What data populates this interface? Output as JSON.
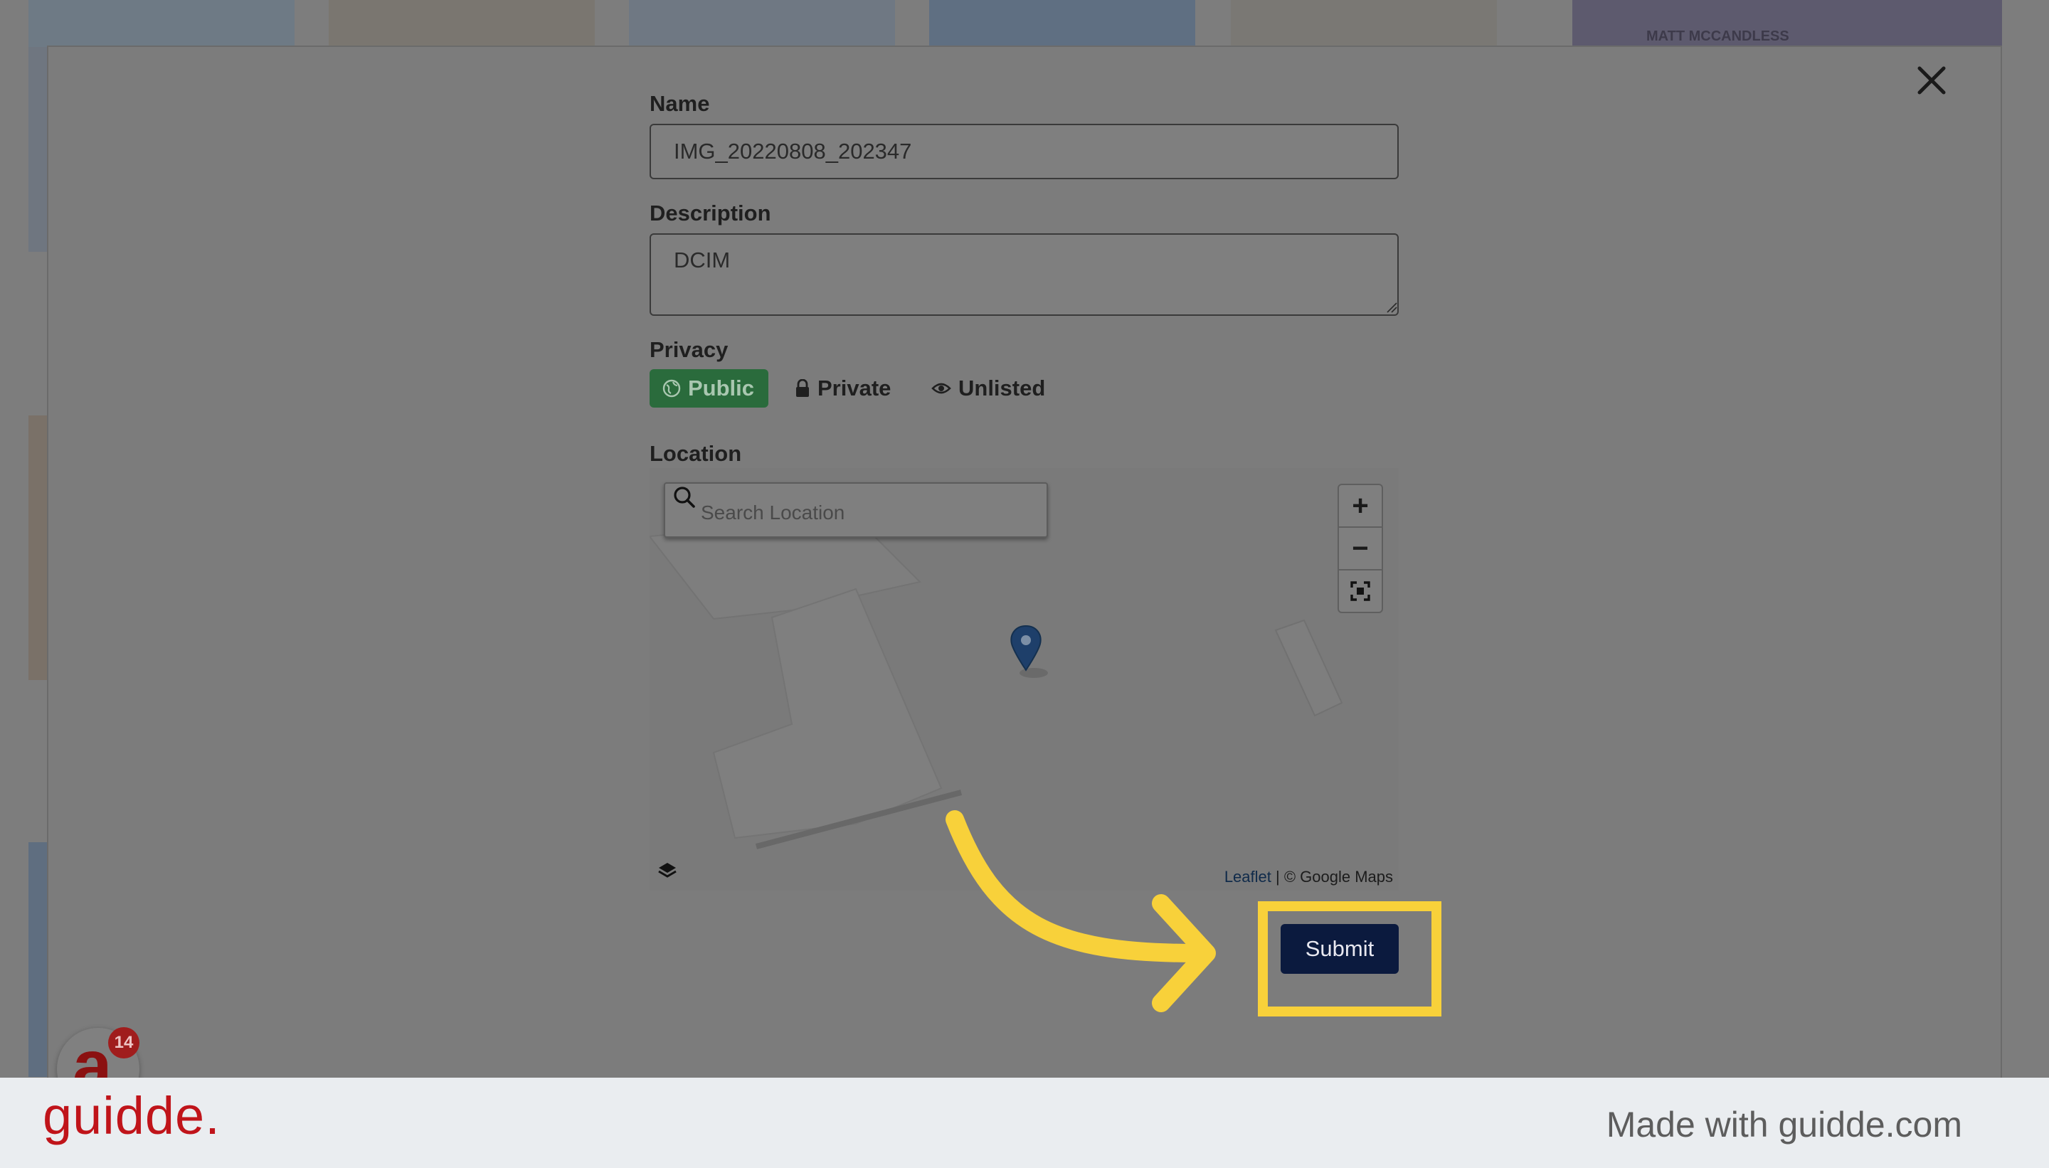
{
  "modal": {
    "close_label": "Close",
    "name_label": "Name",
    "name_value": "IMG_20220808_202347",
    "description_label": "Description",
    "description_value": "DCIM",
    "privacy_label": "Privacy",
    "privacy_options": [
      "Public",
      "Private",
      "Unlisted"
    ],
    "privacy_selected": "Public",
    "location_label": "Location",
    "search_placeholder": "Search Location",
    "zoom_in": "+",
    "zoom_out": "−",
    "attribution_link": "Leaflet",
    "attribution_text": " | © Google Maps",
    "submit_label": "Submit"
  },
  "background": {
    "banner_text": "MATT MCCANDLESS"
  },
  "badge": {
    "letter": "a",
    "count": "14"
  },
  "footer": {
    "logo": "guidde.",
    "made_with": "Made with guidde.com"
  },
  "colors": {
    "public_selected": "#2a6b3c",
    "submit": "#0b1a3e",
    "highlight": "#f8d13a",
    "footer_logo": "#c0141a"
  }
}
